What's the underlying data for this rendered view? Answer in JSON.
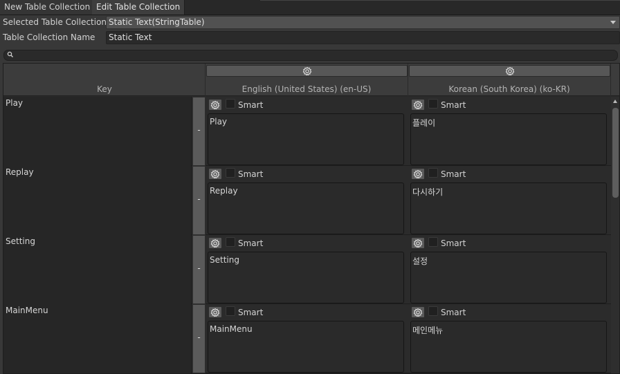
{
  "tabs": [
    {
      "label": "New Table Collection"
    },
    {
      "label": "Edit Table Collection"
    }
  ],
  "selected_collection": {
    "label": "Selected Table Collection",
    "value": "Static Text(StringTable)"
  },
  "collection_name": {
    "label": "Table Collection Name",
    "value": "Static Text"
  },
  "search": {
    "placeholder": "",
    "icon": "search-icon"
  },
  "table": {
    "key_header": "Key",
    "columns": [
      {
        "title": "English (United States) (en-US)",
        "icon": "metadata-icon"
      },
      {
        "title": "Korean (South Korea) (ko-KR)",
        "icon": "metadata-icon"
      }
    ],
    "smart_label": "Smart",
    "remove_label": "-",
    "rows": [
      {
        "key": "Play",
        "values": [
          "Play",
          "플레이"
        ]
      },
      {
        "key": "Replay",
        "values": [
          "Replay",
          "다시하기"
        ]
      },
      {
        "key": "Setting",
        "values": [
          "Setting",
          "설정"
        ]
      },
      {
        "key": "MainMenu",
        "values": [
          "MainMenu",
          "메인메뉴"
        ]
      }
    ]
  },
  "colors": {
    "background": "#383838",
    "field": "#2a2a2a",
    "text": "#d2d2d2"
  }
}
